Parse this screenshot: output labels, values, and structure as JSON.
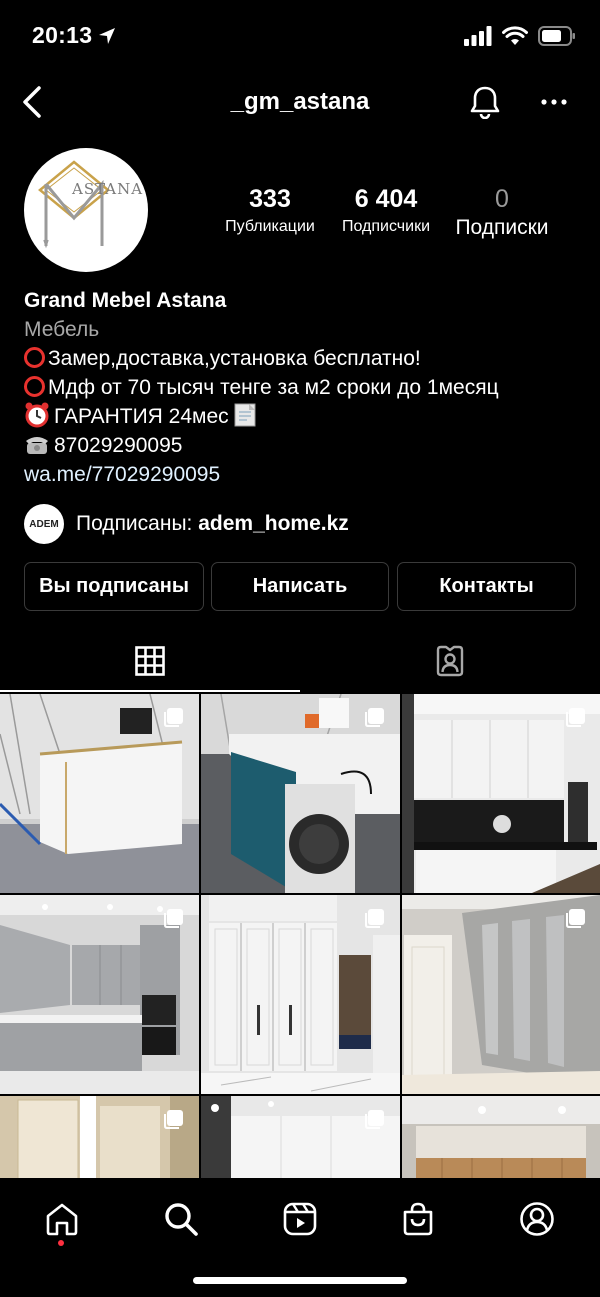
{
  "status_bar": {
    "time": "20:13"
  },
  "header": {
    "username": "_gm_astana"
  },
  "avatar": {
    "logo_text": "ASTANA"
  },
  "stats": {
    "posts_count": "333",
    "posts_label": "Публикации",
    "followers_count": "6 404",
    "followers_label": "Подписчики",
    "following_count": "0",
    "following_label": "Подписки"
  },
  "bio": {
    "name": "Grand Mebel Astana",
    "category": "Мебель",
    "line1": "Замер,доставка,установка бесплатно!",
    "line2": "Мдф от 70 тысяч тенге за м2 сроки до 1месяц",
    "line3": "ГАРАНТИЯ 24мес",
    "phone": "87029290095",
    "link": "wa.me/77029290095"
  },
  "followed_by": {
    "label": "Подписаны: ",
    "account": "adem_home.kz",
    "mini_avatar_text": "ADEM"
  },
  "buttons": {
    "following": "Вы подписаны",
    "message": "Написать",
    "contacts": "Контакты"
  },
  "tabs": {
    "active": "grid"
  },
  "bottom_nav": [
    "home",
    "search",
    "reels",
    "shop",
    "profile"
  ]
}
